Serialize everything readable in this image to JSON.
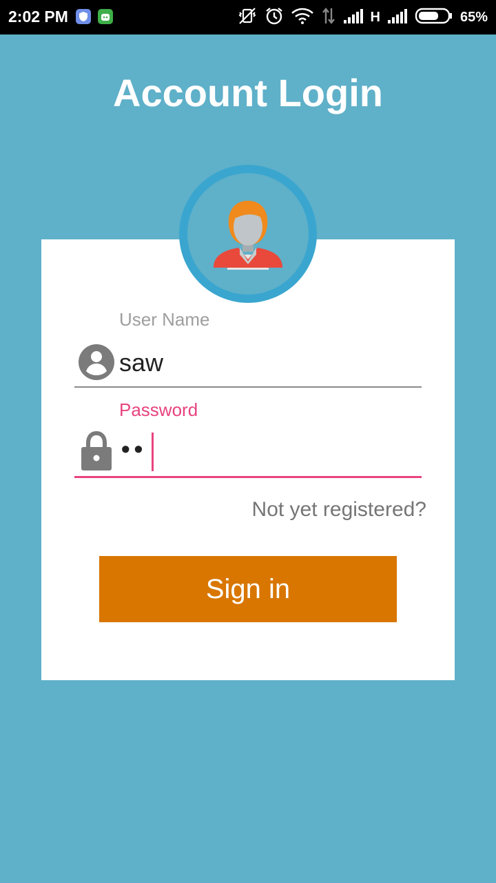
{
  "status_bar": {
    "time": "2:02 PM",
    "network": "H",
    "battery_percent": "65%",
    "battery_level": 0.65,
    "icons": [
      "vpn-shield-icon",
      "app-icon",
      "vibrate-off-icon",
      "alarm-icon",
      "wifi-icon",
      "data-arrows-icon",
      "signal-icon",
      "signal-icon",
      "battery-icon"
    ]
  },
  "page": {
    "title": "Account Login"
  },
  "form": {
    "username": {
      "label": "User Name",
      "value": "saw",
      "icon": "person-icon"
    },
    "password": {
      "label": "Password",
      "masked_value": "••",
      "icon": "lock-icon"
    },
    "register_link": "Not yet registered?",
    "submit_label": "Sign in"
  },
  "colors": {
    "background": "#5fb0c9",
    "accent": "#e8437f",
    "button": "#d87600",
    "avatar_ring": "#3aa6cf"
  }
}
